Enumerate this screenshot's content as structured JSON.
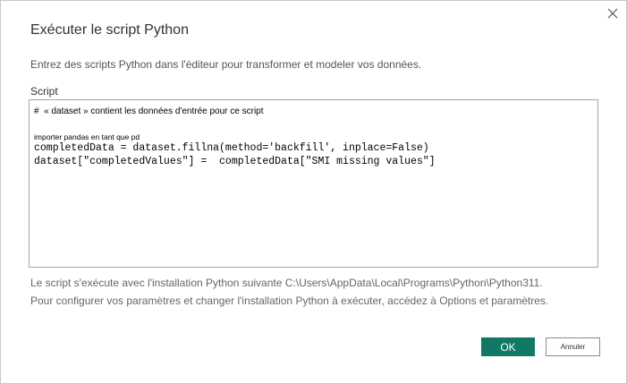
{
  "dialog": {
    "title": "Exécuter le script Python",
    "description": "Entrez des scripts Python dans l'éditeur pour transformer et modeler vos données.",
    "script_label": "Script",
    "close_icon": "close-icon"
  },
  "editor": {
    "lines": [
      "#  « dataset » contient les données d'entrée pour ce script",
      "importer pandas en tant que pd",
      "completedData = dataset.fillna(method='backfill', inplace=False)",
      "dataset[\"completedValues\"] =  completedData[\"SMI missing values\"]"
    ]
  },
  "info": {
    "line1": "Le script s'exécute avec l'installation Python suivante C:\\Users\\AppData\\Local\\Programs\\Python\\Python311.",
    "line2": "Pour configurer vos paramètres et changer l'installation Python à exécuter, accédez à Options et paramètres."
  },
  "buttons": {
    "ok_label": "OK",
    "cancel_label": "Annuler",
    "ok_color": "#117865"
  }
}
